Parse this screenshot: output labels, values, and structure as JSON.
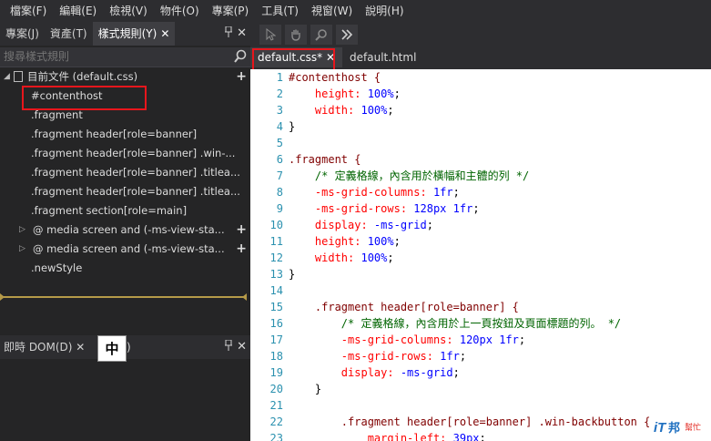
{
  "menu": [
    "檔案(F)",
    "編輯(E)",
    "檢視(V)",
    "物件(O)",
    "專案(P)",
    "工具(T)",
    "視窗(W)",
    "說明(H)"
  ],
  "left_tabs": [
    {
      "label": "專案(J)"
    },
    {
      "label": "資產(T)"
    },
    {
      "label": "樣式規則(Y)",
      "close": "✕"
    }
  ],
  "panel_icons": {
    "pin": "📌",
    "close": "✕"
  },
  "search": {
    "placeholder": "搜尋樣式規則"
  },
  "tree": {
    "root": "目前文件 (default.css)",
    "items": [
      "#contenthost",
      ".fragment",
      ".fragment header[role=banner]",
      ".fragment header[role=banner] .win-...",
      ".fragment header[role=banner] .titlea...",
      ".fragment header[role=banner] .titlea...",
      ".fragment section[role=main]"
    ],
    "media": [
      "@ media screen and (-ms-view-sta...",
      "@ media screen and (-ms-view-sta..."
    ],
    "new_style": ".newStyle"
  },
  "dom_panel": {
    "tab": "即時 DOM(D)",
    "close": "✕",
    "tail": ")"
  },
  "ime": "中",
  "editor_tabs": [
    {
      "label": "default.css*",
      "close": "✕"
    },
    {
      "label": "default.html"
    }
  ],
  "colors": {
    "selector": "#800000",
    "property": "#ff0000",
    "value": "#0000ff",
    "comment": "#006400",
    "line_number": "#2b91af",
    "highlight": "#e8161c"
  },
  "code_lines": [
    {
      "n": "1",
      "parts": [
        [
          "sel",
          "#contenthost {"
        ]
      ]
    },
    {
      "n": "2",
      "parts": [
        [
          "prop",
          "    height: "
        ],
        [
          "val",
          "100%"
        ],
        [
          "t",
          ";"
        ]
      ]
    },
    {
      "n": "3",
      "parts": [
        [
          "prop",
          "    width: "
        ],
        [
          "val",
          "100%"
        ],
        [
          "t",
          ";"
        ]
      ]
    },
    {
      "n": "4",
      "parts": [
        [
          "t",
          "}"
        ]
      ]
    },
    {
      "n": "5",
      "parts": []
    },
    {
      "n": "6",
      "parts": [
        [
          "sel",
          ".fragment {"
        ]
      ]
    },
    {
      "n": "7",
      "parts": [
        [
          "cmt",
          "    /* 定義格線，內含用於橫幅和主體的列 */"
        ]
      ]
    },
    {
      "n": "8",
      "parts": [
        [
          "prop",
          "    -ms-grid-columns: "
        ],
        [
          "val",
          "1fr"
        ],
        [
          "t",
          ";"
        ]
      ]
    },
    {
      "n": "9",
      "parts": [
        [
          "prop",
          "    -ms-grid-rows: "
        ],
        [
          "val",
          "128px 1fr"
        ],
        [
          "t",
          ";"
        ]
      ]
    },
    {
      "n": "10",
      "parts": [
        [
          "prop",
          "    display: "
        ],
        [
          "val",
          "-ms-grid"
        ],
        [
          "t",
          ";"
        ]
      ]
    },
    {
      "n": "11",
      "parts": [
        [
          "prop",
          "    height: "
        ],
        [
          "val",
          "100%"
        ],
        [
          "t",
          ";"
        ]
      ]
    },
    {
      "n": "12",
      "parts": [
        [
          "prop",
          "    width: "
        ],
        [
          "val",
          "100%"
        ],
        [
          "t",
          ";"
        ]
      ]
    },
    {
      "n": "13",
      "parts": [
        [
          "t",
          "}"
        ]
      ]
    },
    {
      "n": "14",
      "parts": []
    },
    {
      "n": "15",
      "parts": [
        [
          "sel",
          "    .fragment header[role=banner] {"
        ]
      ]
    },
    {
      "n": "16",
      "parts": [
        [
          "cmt",
          "        /* 定義格線，內含用於上一頁按鈕及頁面標題的列。 */"
        ]
      ]
    },
    {
      "n": "17",
      "parts": [
        [
          "prop",
          "        -ms-grid-columns: "
        ],
        [
          "val",
          "120px 1fr"
        ],
        [
          "t",
          ";"
        ]
      ]
    },
    {
      "n": "18",
      "parts": [
        [
          "prop",
          "        -ms-grid-rows: "
        ],
        [
          "val",
          "1fr"
        ],
        [
          "t",
          ";"
        ]
      ]
    },
    {
      "n": "19",
      "parts": [
        [
          "prop",
          "        display: "
        ],
        [
          "val",
          "-ms-grid"
        ],
        [
          "t",
          ";"
        ]
      ]
    },
    {
      "n": "20",
      "parts": [
        [
          "t",
          "    }"
        ]
      ]
    },
    {
      "n": "21",
      "parts": []
    },
    {
      "n": "22",
      "parts": [
        [
          "sel",
          "        .fragment header[role=banner] .win-backbutton {"
        ]
      ]
    },
    {
      "n": "23",
      "parts": [
        [
          "prop",
          "            margin-left: "
        ],
        [
          "val",
          "39px"
        ],
        [
          "t",
          ";"
        ]
      ]
    }
  ],
  "logo": {
    "text": "iT邦",
    "sub": "幫忙"
  }
}
